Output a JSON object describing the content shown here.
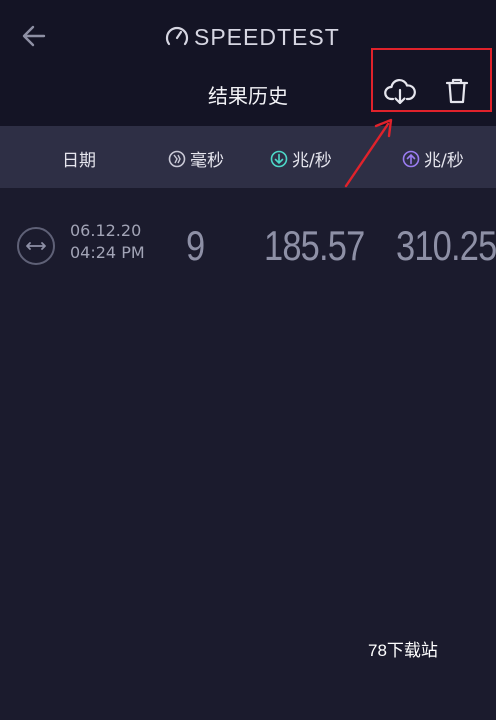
{
  "header": {
    "logo_text": "SPEEDTEST",
    "title": "结果历史",
    "annotation_color": "#e0222b"
  },
  "columns": {
    "date": "日期",
    "ping": "毫秒",
    "download": "兆/秒",
    "upload": "兆/秒",
    "ping_icon_color": "#c9c9d6",
    "download_icon_color": "#4dd8c8",
    "upload_icon_color": "#9a7cf0"
  },
  "results": [
    {
      "date": "06.12.20",
      "time": "04:24 PM",
      "ping": "9",
      "download": "185.57",
      "upload": "310.25"
    }
  ],
  "watermark": "78下载站"
}
